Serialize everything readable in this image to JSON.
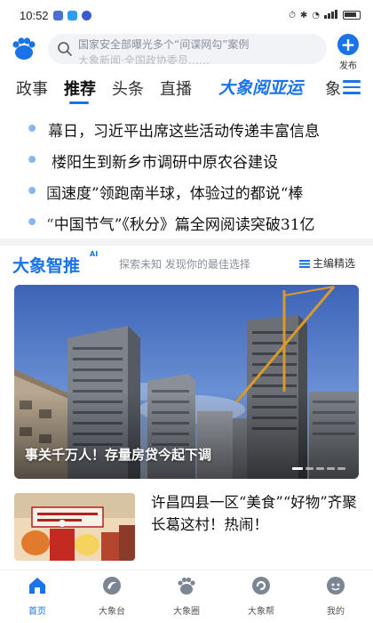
{
  "status_bar": {
    "time": "10:52",
    "right": "…"
  },
  "header": {
    "search_placeholder": "国家安全部曝光多个“间谍网勾”案例",
    "search_placeholder_next": "大象新闻·全国政协委员……",
    "publish_label": "发布"
  },
  "tabs": {
    "items": [
      "政事",
      "推荐",
      "头条",
      "直播"
    ],
    "active": "推荐",
    "brand": "大象阅亚运",
    "cut": "象"
  },
  "headlines": [
    "幕日，习近平出席这些活动传递丰富信息",
    "楼阳生到新乡市调研中原农谷建设",
    "国速度”领跑南半球，体验过的都说“棒",
    "“中国节气”《秋分》篇全网阅读突破31亿"
  ],
  "ai_section": {
    "title": "大象智推",
    "badge": "AI",
    "subtitle": "探索未知  发现你的最佳选择",
    "editor_pick": "主编精选"
  },
  "hero": {
    "caption": "事关千万人！存量房贷今起下调",
    "slides": 5,
    "active_slide": 1
  },
  "news_item": {
    "title": "许昌四县一区“美食”“好物”齐聚长葛这村！热闹！"
  },
  "bottom_nav": [
    {
      "label": "首页",
      "icon": "home-icon",
      "active": true
    },
    {
      "label": "大象台",
      "icon": "tv-icon",
      "active": false
    },
    {
      "label": "大象圈",
      "icon": "paw-icon",
      "active": false
    },
    {
      "label": "大象帮",
      "icon": "help-icon",
      "active": false
    },
    {
      "label": "我的",
      "icon": "profile-icon",
      "active": false
    }
  ],
  "colors": {
    "accent": "#1a73e8",
    "text": "#111111",
    "muted": "#8a8f99"
  }
}
